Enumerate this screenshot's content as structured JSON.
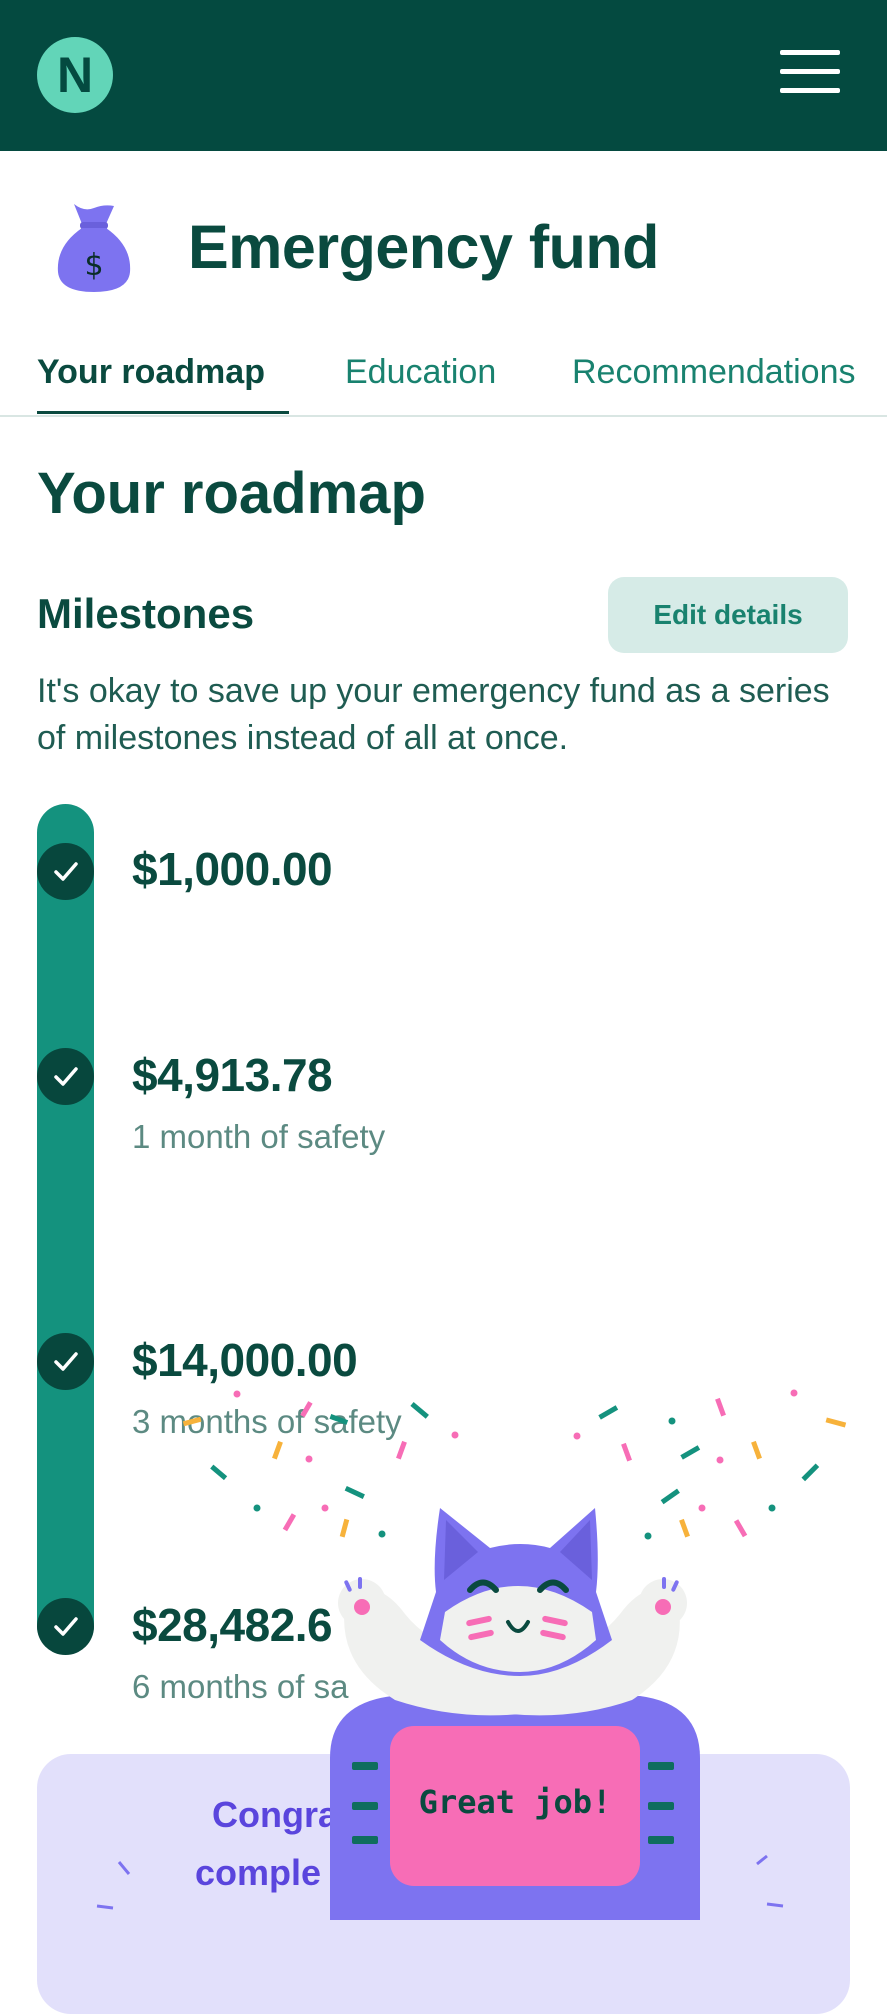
{
  "header": {
    "logo_letter": "N"
  },
  "page": {
    "title": "Emergency fund"
  },
  "tabs": [
    {
      "label": "Your roadmap",
      "active": true
    },
    {
      "label": "Education",
      "active": false
    },
    {
      "label": "Recommendations",
      "active": false
    }
  ],
  "roadmap": {
    "heading": "Your roadmap",
    "milestones_title": "Milestones",
    "edit_button": "Edit details",
    "description": "It's okay to save up your emergency fund as a series of milestones instead of all at once.",
    "milestones": [
      {
        "amount": "$1,000.00",
        "label": "",
        "completed": true
      },
      {
        "amount": "$4,913.78",
        "label": "1 month of safety",
        "completed": true
      },
      {
        "amount": "$14,000.00",
        "label": "3 months of safety",
        "completed": true
      },
      {
        "amount": "$28,482.6",
        "label": "6 months of sa",
        "completed": true
      }
    ]
  },
  "congrats": {
    "line1": "Congra",
    "line2": "comple"
  },
  "celebration": {
    "sign_text": "Great job!"
  },
  "colors": {
    "header_bg": "#044a40",
    "accent_teal": "#14927e",
    "dark_green": "#0a4a3f",
    "purple": "#7d73f0",
    "pink": "#f76db6"
  }
}
